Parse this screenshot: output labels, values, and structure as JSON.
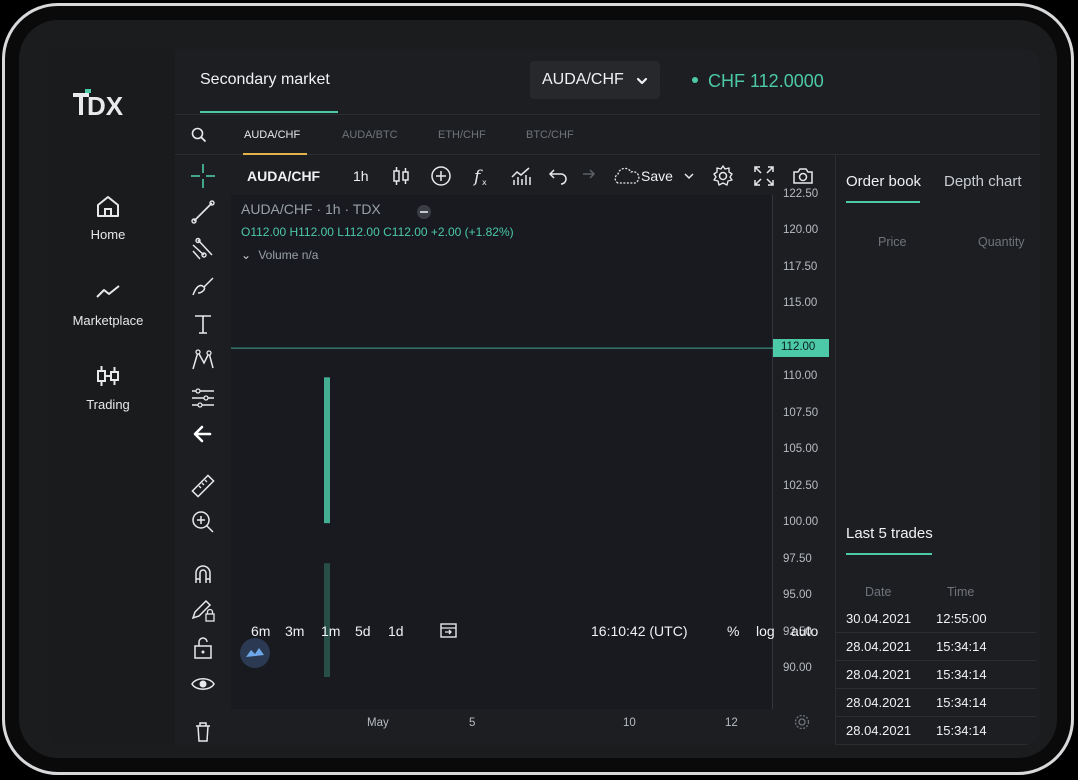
{
  "nav": {
    "logo_text": "TDX",
    "items": [
      {
        "label": "Home",
        "icon": "home-icon"
      },
      {
        "label": "Marketplace",
        "icon": "trend-icon"
      },
      {
        "label": "Trading",
        "icon": "candles-icon"
      }
    ]
  },
  "header": {
    "tab_label": "Secondary market",
    "pair_select": "AUDA/CHF",
    "price": "CHF 112.0000"
  },
  "pair_tabs": [
    "AUDA/CHF",
    "AUDA/BTC",
    "ETH/CHF",
    "BTC/CHF"
  ],
  "chart_header": {
    "symbol": "AUDA/CHF",
    "interval": "1h",
    "save_label": "Save"
  },
  "legend": {
    "title": "AUDA/CHF · 1h · TDX",
    "ohlc": "O112.00 H112.00 L112.00 C112.00 +2.00 (+1.82%)",
    "volume": "Volume  n/a"
  },
  "chart_data": {
    "type": "bar",
    "title": "AUDA/CHF · 1h · TDX",
    "x_tick_labels": [
      "May",
      "5",
      "10",
      "12"
    ],
    "y_tick_labels": [
      "122.50",
      "120.00",
      "117.50",
      "115.00",
      "112.00",
      "110.00",
      "107.50",
      "105.00",
      "102.50",
      "100.00",
      "97.50",
      "95.00",
      "92.50",
      "90.00"
    ],
    "ylim": [
      90,
      122.5
    ],
    "last_price": 112.0,
    "last_price_label": "112.00",
    "price_candle": {
      "open": 100.0,
      "close": 110.0,
      "low": 100.0,
      "high": 110.0
    },
    "volume_bar_relative": 0.55,
    "grid": false
  },
  "time_ranges": [
    "6m",
    "3m",
    "1m",
    "5d",
    "1d"
  ],
  "clock": "16:10:42 (UTC)",
  "scale_options": [
    "%",
    "log",
    "auto"
  ],
  "right_panel": {
    "tabs": [
      "Order book",
      "Depth chart"
    ],
    "columns": [
      "Price",
      "Quantity"
    ],
    "trades_title": "Last 5 trades",
    "trade_columns": [
      "Date",
      "Time"
    ],
    "trades": [
      {
        "date": "30.04.2021",
        "time": "12:55:00"
      },
      {
        "date": "28.04.2021",
        "time": "15:34:14"
      },
      {
        "date": "28.04.2021",
        "time": "15:34:14"
      },
      {
        "date": "28.04.2021",
        "time": "15:34:14"
      },
      {
        "date": "28.04.2021",
        "time": "15:34:14"
      }
    ]
  },
  "colors": {
    "accent": "#4cc9a7",
    "tab_accent": "#e2b24b",
    "background": "#1d1e21"
  }
}
